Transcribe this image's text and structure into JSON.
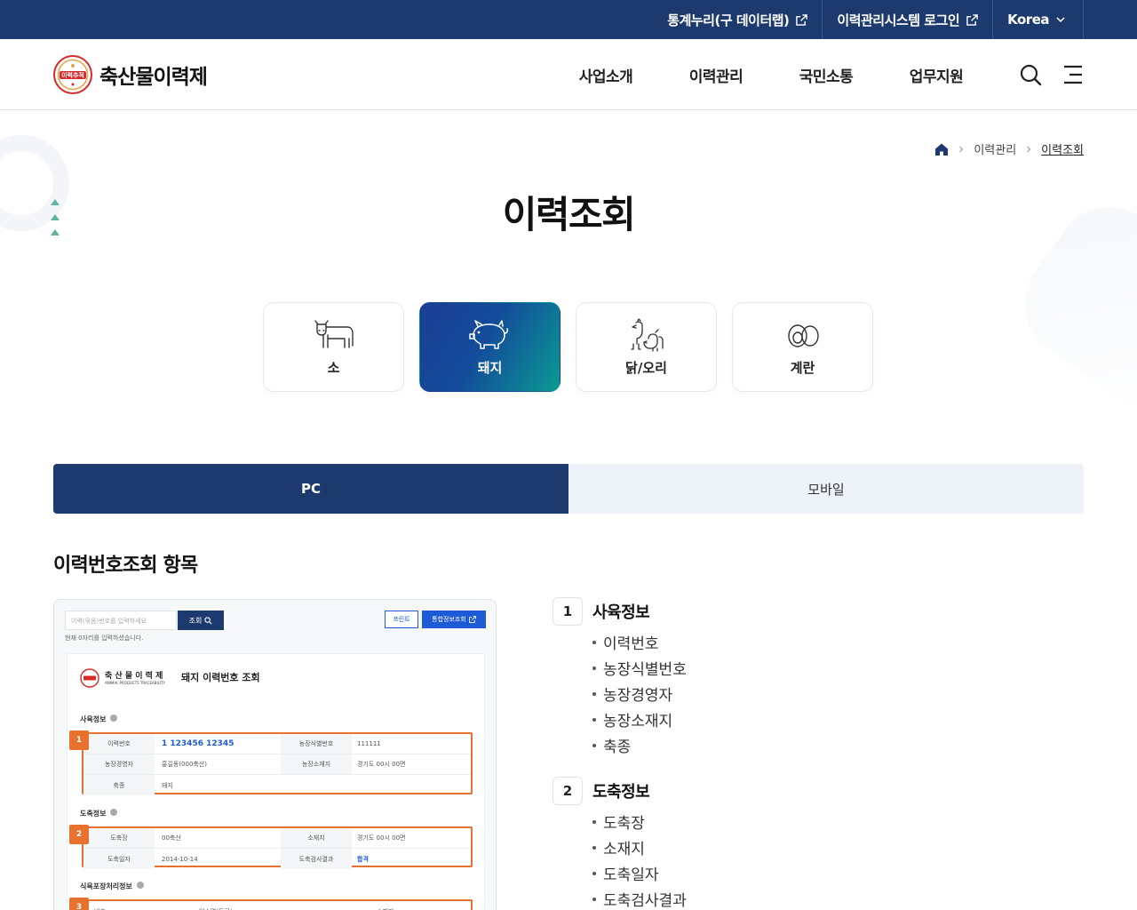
{
  "topbar": {
    "links": [
      {
        "label": "통계누리(구 데이터랩)",
        "icon": "external-link-icon"
      },
      {
        "label": "이력관리시스템 로그인",
        "icon": "external-link-icon"
      },
      {
        "label": "Korea",
        "icon": "chevron-down-icon"
      }
    ]
  },
  "header": {
    "logo_text": "축산물이력제",
    "logo_seal_text": "이력추적",
    "nav": [
      "사업소개",
      "이력관리",
      "국민소통",
      "업무지원"
    ],
    "search_icon": "search-icon",
    "menu_icon": "hamburger-menu-icon"
  },
  "breadcrumb": {
    "home_icon": "home-icon",
    "items": [
      "이력관리",
      "이력조회"
    ]
  },
  "page_title": "이력조회",
  "animals": [
    {
      "label": "소",
      "icon": "cow-icon",
      "active": false
    },
    {
      "label": "돼지",
      "icon": "pig-icon",
      "active": true
    },
    {
      "label": "닭/오리",
      "icon": "chicken-duck-icon",
      "active": false
    },
    {
      "label": "계란",
      "icon": "egg-icon",
      "active": false
    }
  ],
  "tabs": [
    {
      "label": "PC",
      "active": true
    },
    {
      "label": "모바일",
      "active": false
    }
  ],
  "section_title": "이력번호조회 항목",
  "preview": {
    "input_placeholder": "이력(묶음)번호를 입력하세요",
    "search_label": "조회",
    "hint": "현재 0자리를 입력하셨습니다.",
    "print_label": "프린트",
    "integrated_label": "통합정보조회",
    "brand": "축 산 물 이 력 제",
    "brand_sub": "ANIMAL PRODUCTS TRACEABILITY",
    "heading": "돼지 이력번호 조회",
    "sections": [
      {
        "title": "사육정보",
        "number": "1",
        "rows": [
          {
            "k1": "이력번호",
            "v1": "1 123456 12345",
            "k2": "농장식별번호",
            "v2": "111111"
          },
          {
            "k1": "농장경영자",
            "v1": "홍길동(000축산)",
            "k2": "농장소재지",
            "v2": "경기도 00시 00면"
          },
          {
            "k1": "축종",
            "v1": "돼지",
            "k2": "",
            "v2": ""
          }
        ]
      },
      {
        "title": "도축정보",
        "number": "2",
        "rows": [
          {
            "k1": "도축장",
            "v1": "00축산",
            "k2": "소재지",
            "v2": "경기도 00시 00면"
          },
          {
            "k1": "도축일자",
            "v1": "2014-10-14",
            "k2": "도축검사결과",
            "v2": "합격"
          }
        ]
      },
      {
        "title": "식육포장처리정보",
        "number": "3",
        "rows": [
          {
            "k1": "번호",
            "v1": "",
            "k2": "업소명(등급)",
            "v2": "소재지"
          }
        ]
      }
    ]
  },
  "item_groups": [
    {
      "number": "1",
      "title": "사육정보",
      "items": [
        "이력번호",
        "농장식별번호",
        "농장경영자",
        "농장소재지",
        "축종"
      ]
    },
    {
      "number": "2",
      "title": "도축정보",
      "items": [
        "도축장",
        "소재지",
        "도축일자",
        "도축검사결과"
      ]
    }
  ],
  "colors": {
    "primary_navy": "#1d3a6e",
    "accent_orange": "#e8712e",
    "accent_blue": "#1d5bd6",
    "gradient_start": "#1b3e94",
    "gradient_end": "#0a9a94"
  }
}
